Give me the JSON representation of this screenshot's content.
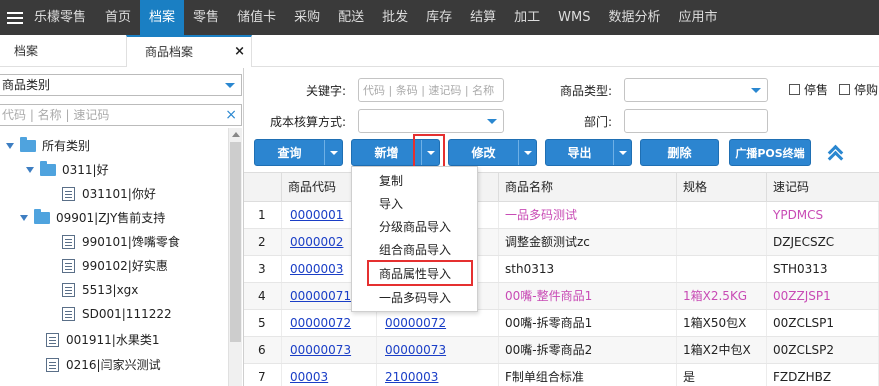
{
  "nav": {
    "brand": "乐檬零售",
    "items": [
      "首页",
      "档案",
      "零售",
      "储值卡",
      "采购",
      "配送",
      "批发",
      "库存",
      "结算",
      "加工",
      "WMS",
      "数据分析",
      "应用市"
    ],
    "active_index": 1,
    "active_color": "#1a7fc3"
  },
  "tabs": [
    {
      "label": "档案"
    },
    {
      "label": "商品档案",
      "close": "×"
    }
  ],
  "left": {
    "category_select": "商品类别",
    "search_placeholder": "代码 | 名称 | 速记码",
    "clear": "×",
    "tree": [
      {
        "label": "所有类别",
        "kind": "folder",
        "expanded": true
      },
      {
        "label": "0311|好",
        "kind": "folder",
        "expanded": true
      },
      {
        "label": "031101|你好",
        "kind": "leaf"
      },
      {
        "label": "09901|ZJY售前支持",
        "kind": "folder",
        "expanded": true
      },
      {
        "label": "990101|馋嘴零食",
        "kind": "leaf"
      },
      {
        "label": "990102|好实惠",
        "kind": "leaf"
      },
      {
        "label": "5513|xgx",
        "kind": "leaf"
      },
      {
        "label": "SD001|111222",
        "kind": "leaf"
      },
      {
        "label": "001911|水果类1",
        "kind": "leaf"
      },
      {
        "label": "0216|闫家兴测试",
        "kind": "leaf"
      }
    ]
  },
  "filters": {
    "keyword_label": "关键字:",
    "keyword_placeholder": "代码 | 条码 | 速记码 | 名称",
    "goods_type_label": "商品类型:",
    "cost_method_label": "成本核算方式:",
    "dept_label": "部门:",
    "stop_sale": "停售",
    "stop_purchase": "停购"
  },
  "buttons": {
    "query": "查询",
    "add": "新增",
    "edit": "修改",
    "export": "导出",
    "delete": "删除",
    "broadcast": "广播POS终端"
  },
  "dropdown": {
    "items": [
      "复制",
      "导入",
      "分级商品导入",
      "组合商品导入",
      "商品属性导入",
      "一品多码导入"
    ],
    "highlighted_index": 4
  },
  "table": {
    "headers": [
      "商品代码",
      "",
      "商品名称",
      "规格",
      "速记码"
    ],
    "rows": [
      {
        "no": "1",
        "code": "0000001",
        "code2": "",
        "name": "一品多码测试",
        "spec": "",
        "mnemonic": "YPDMCS",
        "pink": true
      },
      {
        "no": "2",
        "code": "0000002",
        "code2": "",
        "name": "调整金额测试zc",
        "spec": "",
        "mnemonic": "DZJECSZC",
        "pink": false
      },
      {
        "no": "3",
        "code": "0000003",
        "code2": "",
        "name": "sth0313",
        "spec": "",
        "mnemonic": "STH0313",
        "pink": false
      },
      {
        "no": "4",
        "code": "00000071",
        "code2": "",
        "name": "00嘴-整件商品1",
        "spec": "1箱X2.5KG",
        "mnemonic": "00ZZJSP1",
        "pink": true
      },
      {
        "no": "5",
        "code": "00000072",
        "code2": "00000072",
        "name": "00嘴-拆零商品1",
        "spec": "1箱X50包X",
        "mnemonic": "00ZCLSP1",
        "pink": false
      },
      {
        "no": "6",
        "code": "00000073",
        "code2": "00000073",
        "name": "00嘴-拆零商品2",
        "spec": "1箱X2中包X",
        "mnemonic": "00ZCLSP2",
        "pink": false
      },
      {
        "no": "7",
        "code": "00003",
        "code2": "2100003",
        "name": "F制单组合标准",
        "spec": "是",
        "mnemonic": "FZDZHBZ",
        "pink": false
      }
    ]
  },
  "colors": {
    "nav_bg": "#3a3a3a",
    "button_blue": "#2c85d0",
    "highlight_red": "#e53030",
    "pink_text": "#c84bb5",
    "link_blue": "#1a3ec6"
  }
}
